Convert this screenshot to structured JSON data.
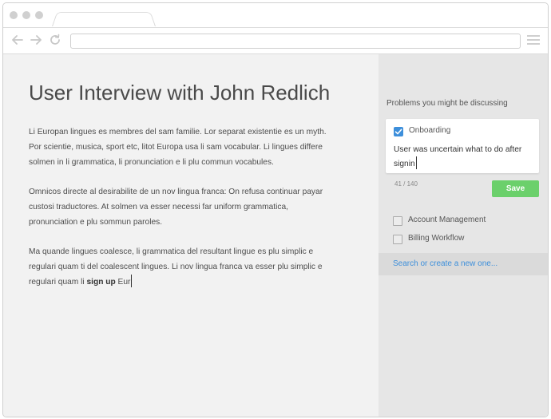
{
  "document": {
    "title": "User Interview with John Redlich",
    "paragraphs": [
      "Li Europan lingues es membres del sam familie. Lor separat existentie es un myth. Por scientie, musica, sport etc, litot Europa usa li sam vocabular. Li lingues differe solmen in li grammatica, li pronunciation e li plu commun vocabules.",
      "Omnicos directe al desirabilite de un nov lingua franca: On refusa continuar payar custosi traductores. At solmen va esser necessi far uniform grammatica, pronunciation e plu sommun paroles."
    ],
    "last_paragraph": {
      "text_before": "Ma quande lingues coalesce, li grammatica del resultant lingue es plu simplic e regulari quam ti del coalescent lingues. Li nov lingua franca va esser plu simplic e regulari quam li ",
      "highlight": "sign up",
      "text_after": " Eur"
    }
  },
  "sidebar": {
    "heading": "Problems you might be discussing",
    "active_problem": {
      "label": "Onboarding",
      "checked": true,
      "note": "User was uncertain what to do after signin",
      "counter": "41 / 140"
    },
    "save_label": "Save",
    "options": [
      {
        "label": "Account Management",
        "checked": false
      },
      {
        "label": "Billing Workflow",
        "checked": false
      }
    ],
    "search_link": "Search or create a new one..."
  },
  "colors": {
    "accent_blue": "#3d8fdb",
    "save_green": "#6bd06b",
    "document_bg": "#f2f2f2",
    "sidebar_bg": "#e6e6e6"
  },
  "icons": [
    "back-arrow-icon",
    "forward-arrow-icon",
    "reload-icon",
    "hamburger-menu-icon",
    "checkmark-icon"
  ]
}
